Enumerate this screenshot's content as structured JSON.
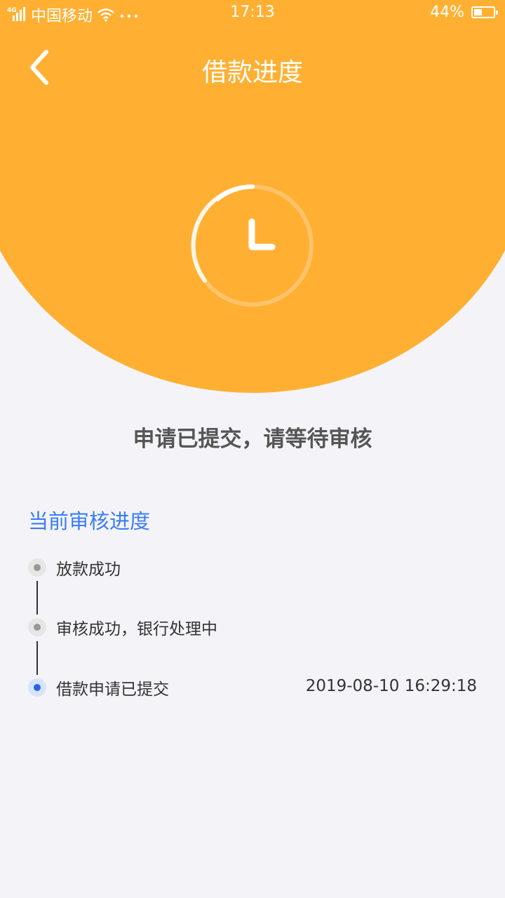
{
  "status_bar": {
    "network_tag": "4G",
    "carrier": "中国移动",
    "time": "17:13",
    "battery_percent": "44%",
    "battery_level": 0.44
  },
  "nav": {
    "title": "借款进度"
  },
  "main": {
    "status_message": "申请已提交，请等待审核",
    "section_title": "当前审核进度"
  },
  "timeline": [
    {
      "label": "放款成功",
      "time": "",
      "state": "done"
    },
    {
      "label": "审核成功，银行处理中",
      "time": "",
      "state": "done"
    },
    {
      "label": "借款申请已提交",
      "time": "2019-08-10 16:29:18",
      "state": "current"
    }
  ],
  "colors": {
    "header": "#ffb033",
    "accent_blue": "#3b7cf5",
    "current_dot": "#2b62e8"
  }
}
